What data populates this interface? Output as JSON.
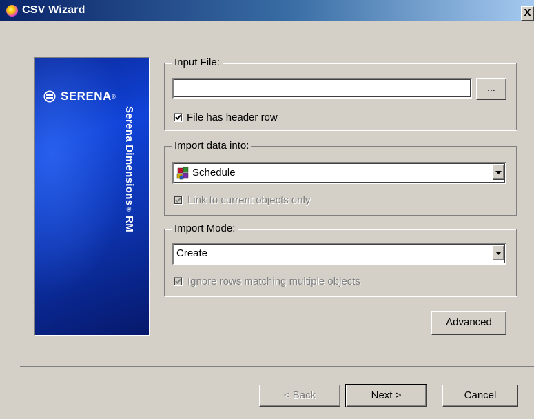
{
  "window": {
    "title": "CSV Wizard",
    "close_label": "X",
    "title_icon": "wizard-app-icon",
    "titlebar_color_start": "#0a246a",
    "titlebar_color_end": "#a6caf0"
  },
  "banner": {
    "logo_text": "SERENA",
    "product_text": "Serena Dimensions",
    "product_suffix": " RM",
    "background_color": "#1043d8"
  },
  "input_file": {
    "legend": "Input File:",
    "value": "",
    "browse_label": "...",
    "header_row_label": "File has header row",
    "header_row_checked": true
  },
  "import_data": {
    "legend": "Import data into:",
    "selected": "Schedule",
    "selected_icon": "schedule-cubes-icon",
    "link_label": "Link to current objects only",
    "link_checked": true,
    "link_enabled": false
  },
  "import_mode": {
    "legend": "Import Mode:",
    "selected": "Create",
    "ignore_label": "Ignore rows matching multiple objects",
    "ignore_checked": true,
    "ignore_enabled": false
  },
  "buttons": {
    "advanced": "Advanced",
    "back": "< Back",
    "next": "Next >",
    "cancel": "Cancel"
  }
}
